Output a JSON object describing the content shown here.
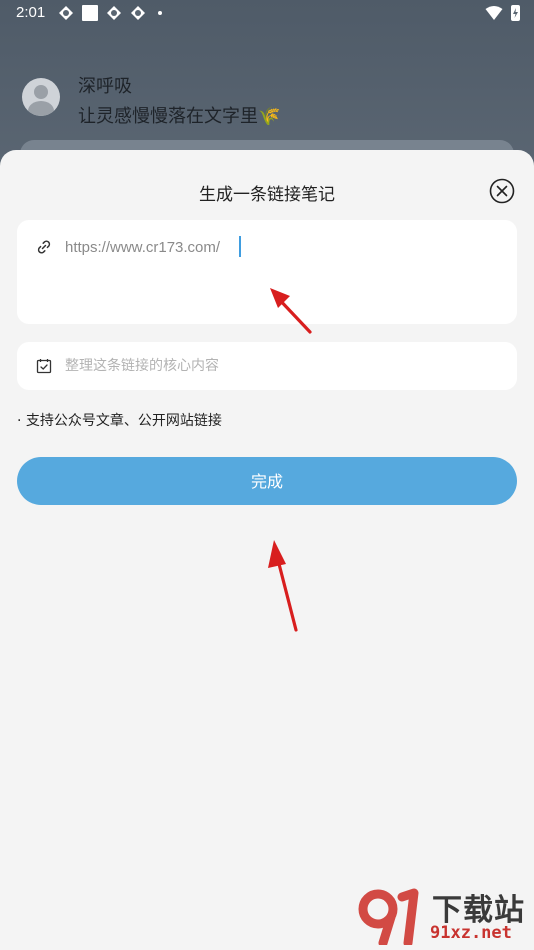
{
  "status_bar": {
    "time": "2:01",
    "left_icons": [
      "sync-icon",
      "square-icon",
      "sync-icon",
      "sync-icon",
      "dot-icon"
    ],
    "right_icons": [
      "wifi-icon",
      "battery-charging-icon"
    ]
  },
  "profile": {
    "name": "深呼吸",
    "bio": "让灵感慢慢落在文字里🌾"
  },
  "sheet": {
    "title": "生成一条链接笔记",
    "url_input": {
      "value": "https://www.cr173.com/",
      "icon": "link-icon"
    },
    "note_input": {
      "placeholder": "整理这条链接的核心内容",
      "icon": "calendar-check-icon"
    },
    "hint": "· 支持公众号文章、公开网站链接",
    "done_label": "完成"
  },
  "watermark": {
    "logo_text": "91",
    "title": "下载站",
    "url": "91xz.net"
  },
  "colors": {
    "accent": "#56a9de",
    "annotation": "#d81e1e",
    "sheet_bg": "#f4f4f4",
    "backdrop": "#68737f"
  }
}
